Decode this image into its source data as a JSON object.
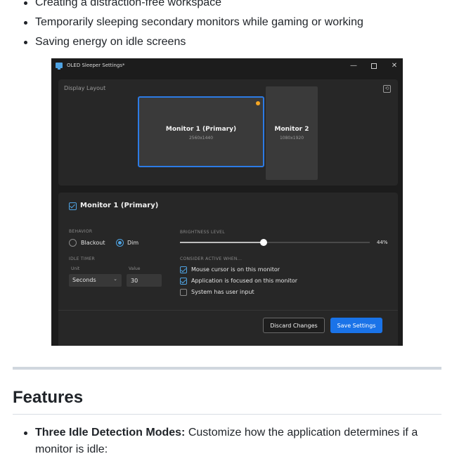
{
  "readme": {
    "top_bullets": [
      "Creating a distraction-free workspace",
      "Temporarily sleeping secondary monitors while gaming or working",
      "Saving energy on idle screens"
    ],
    "features_heading": "Features",
    "feature_bullets": [
      {
        "bold": "Three Idle Detection Modes:",
        "text": " Customize how the application determines if a monitor is idle:"
      }
    ]
  },
  "app": {
    "window_title": "OLED Sleeper Settings*",
    "window_controls": {
      "minimize": "—",
      "maximize": "",
      "close": "✕"
    },
    "display_layout": {
      "label": "Display Layout",
      "tool_icon": "refresh-icon",
      "monitors": [
        {
          "name": "Monitor 1 (Primary)",
          "resolution": "2560x1440",
          "selected": true,
          "indicator_color": "#f5a623"
        },
        {
          "name": "Monitor 2",
          "resolution": "1080x1920",
          "selected": false
        }
      ]
    },
    "settings": {
      "monitor_title": "Monitor 1 (Primary)",
      "monitor_enabled": true,
      "behavior_label": "BEHAVIOR",
      "behavior_options": [
        {
          "label": "Blackout",
          "selected": false
        },
        {
          "label": "Dim",
          "selected": true
        }
      ],
      "idle_timer_label": "IDLE TIMER",
      "unit_label": "Unit",
      "unit_value": "Seconds",
      "value_label": "Value",
      "value": "30",
      "brightness_label": "BRIGHTNESS LEVEL",
      "brightness_value": 44,
      "brightness_text": "44%",
      "consider_active_label": "CONSIDER ACTIVE WHEN...",
      "consider_active_options": [
        {
          "label": "Mouse cursor is on this monitor",
          "checked": true
        },
        {
          "label": "Application is focused on this monitor",
          "checked": true
        },
        {
          "label": "System has user input",
          "checked": false
        }
      ],
      "discard_label": "Discard Changes",
      "save_label": "Save Settings"
    },
    "colors": {
      "accent": "#2c7be5",
      "save_button": "#1a73e8",
      "background": "#1c1c1c",
      "panel": "#272727"
    }
  }
}
